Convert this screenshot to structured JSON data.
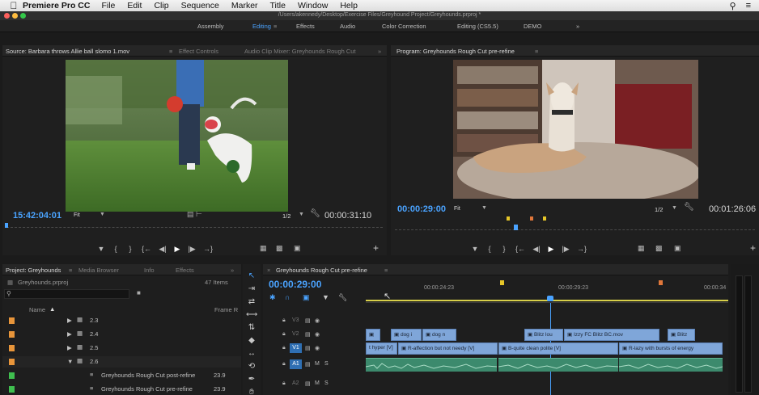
{
  "menubar": {
    "app_name": "Premiere Pro CC",
    "items": [
      "File",
      "Edit",
      "Clip",
      "Sequence",
      "Marker",
      "Title",
      "Window",
      "Help"
    ]
  },
  "titlebar": {
    "path": "/Users/akennedy/Desktop/Exercise Files/Greyhound Project/Greyhounds.prproj *"
  },
  "workspaces": [
    "Assembly",
    "Editing",
    "Effects",
    "Audio",
    "Color Correction",
    "Editing (CS5.5)",
    "DEMO"
  ],
  "source": {
    "tab_title": "Source: Barbara throws Allie ball slomo 1.mov",
    "other_tabs": [
      "Effect Controls",
      "Audio Clip Mixer: Greyhounds Rough Cut"
    ],
    "timecode_in": "15:42:04:01",
    "fit": "Fit",
    "resolution": "1/2",
    "timecode_duration": "00:00:31:10"
  },
  "program": {
    "tab_title": "Program: Greyhounds Rough Cut pre-refine",
    "timecode_in": "00:00:29:00",
    "fit": "Fit",
    "resolution": "1/2",
    "timecode_duration": "00:01:26:06"
  },
  "project": {
    "tabs": [
      "Project: Greyhounds",
      "Media Browser",
      "Info",
      "Effects"
    ],
    "file": "Greyhounds.prproj",
    "item_count": "47 Items",
    "col_name": "Name",
    "col_frame": "Frame R",
    "rows": [
      {
        "label": "2.3",
        "fps": ""
      },
      {
        "label": "2.4",
        "fps": ""
      },
      {
        "label": "2.5",
        "fps": ""
      },
      {
        "label": "2.6",
        "fps": ""
      },
      {
        "label": "Greyhounds Rough Cut post-refine",
        "fps": "23.9"
      },
      {
        "label": "Greyhounds Rough Cut pre-refine",
        "fps": "23.9"
      }
    ],
    "colors": [
      "#e8953a",
      "#e8953a",
      "#e8953a",
      "#e8953a",
      "#3fbf4f",
      "#3fbf4f"
    ]
  },
  "timeline": {
    "tab_title": "Greyhounds Rough Cut pre-refine",
    "timecode": "00:00:29:00",
    "ruler": [
      "00:00:24:23",
      "00:00:29:23",
      "00:00:34"
    ],
    "tracks": [
      "V3",
      "V2",
      "V1",
      "A1",
      "A2"
    ],
    "v2_clips": [
      "dog i",
      "dog n",
      "Blitz lou",
      "Izzy FC Blitz BC.mov",
      "Blitz"
    ],
    "v1_clips": [
      "t hyper [V]",
      "R-affection but not needy [V]",
      "B-quite clean polite [V]",
      "R-lazy with bursts of energy"
    ]
  }
}
